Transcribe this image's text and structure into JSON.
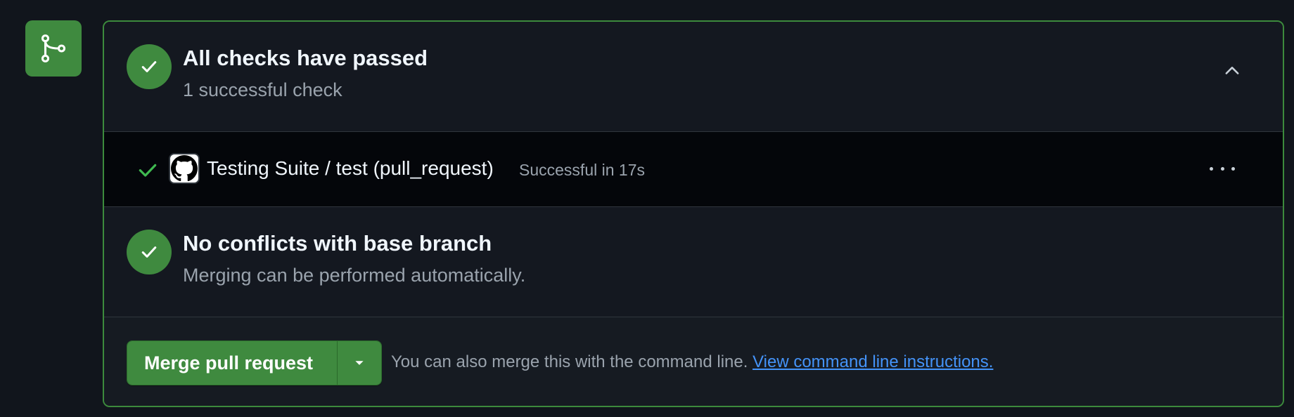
{
  "checks": {
    "title": "All checks have passed",
    "subtitle": "1 successful check"
  },
  "run": {
    "name": "Testing Suite / test (pull_request)",
    "status": "Successful in 17s"
  },
  "conflicts": {
    "title": "No conflicts with base branch",
    "subtitle": "Merging can be performed automatically."
  },
  "merge": {
    "button_label": "Merge pull request",
    "note": "You can also merge this with the command line.",
    "link_label": "View command line instructions."
  },
  "colors": {
    "success": "#3f8a3f",
    "success_border": "#3c8a3c",
    "link": "#4493f8"
  },
  "icons": [
    "git-merge-icon",
    "check-icon",
    "chevron-up-icon",
    "github-logo-icon",
    "kebab-horizontal-icon",
    "triangle-down-icon"
  ]
}
